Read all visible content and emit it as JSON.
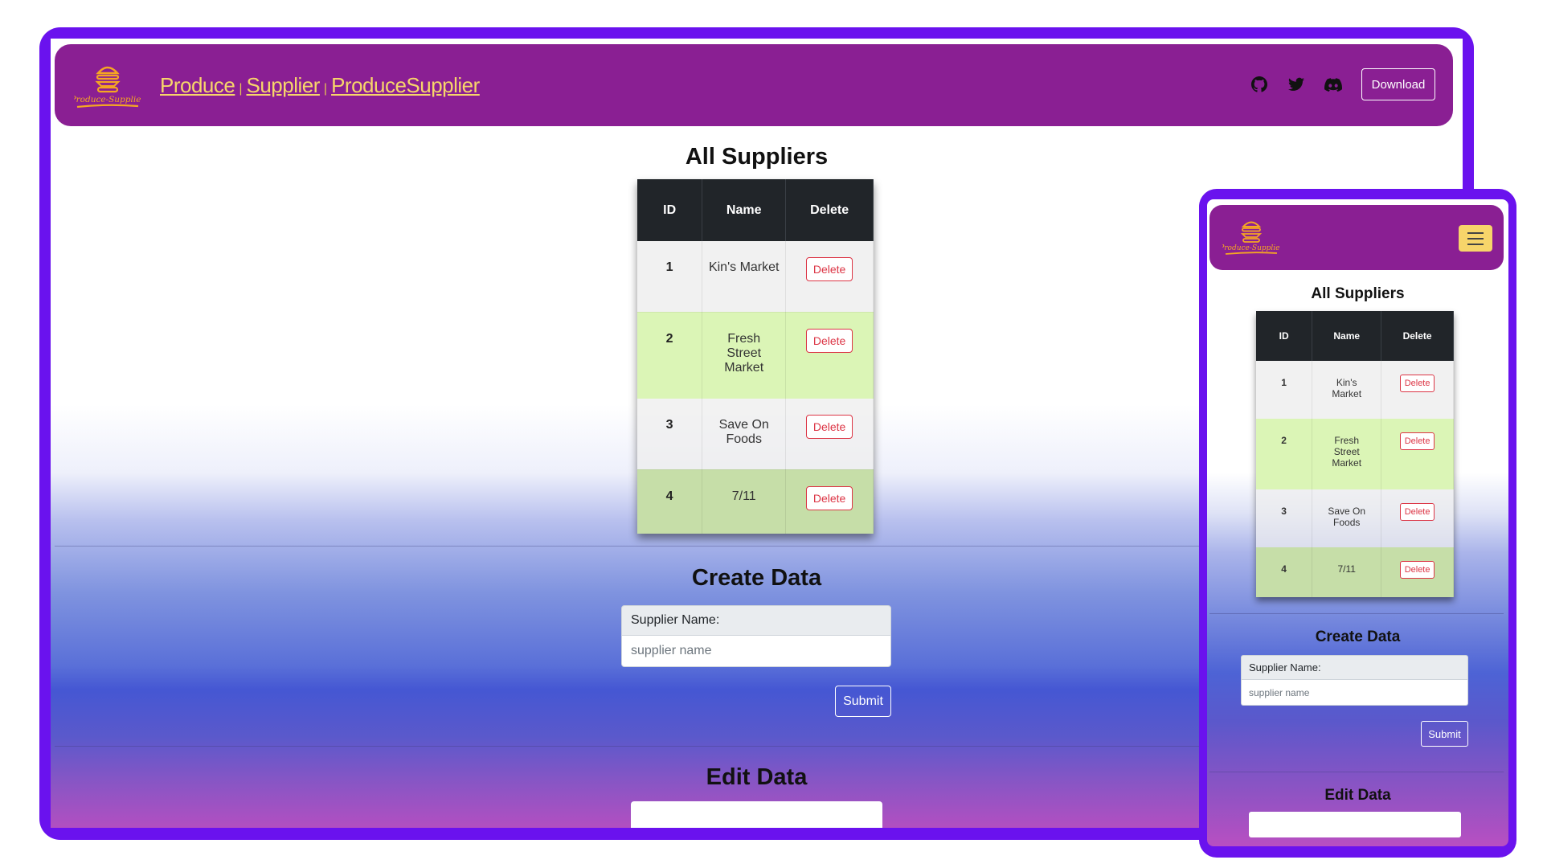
{
  "brand": {
    "logo_text": "Produce-Supplier",
    "logo_color": "#f5a623"
  },
  "nav": {
    "links": [
      "Produce",
      "Supplier",
      "ProduceSupplier"
    ],
    "separator": "|",
    "download_label": "Download",
    "icons": [
      "github-icon",
      "twitter-icon",
      "discord-icon"
    ]
  },
  "suppliers": {
    "title": "All Suppliers",
    "columns": [
      "ID",
      "Name",
      "Delete"
    ],
    "rows": [
      {
        "id": "1",
        "name": "Kin's Market",
        "action": "Delete"
      },
      {
        "id": "2",
        "name": "Fresh Street Market",
        "action": "Delete"
      },
      {
        "id": "3",
        "name": "Save On Foods",
        "action": "Delete"
      },
      {
        "id": "4",
        "name": "7/11",
        "action": "Delete"
      }
    ]
  },
  "create": {
    "title": "Create Data",
    "label": "Supplier Name:",
    "placeholder": "supplier name",
    "submit_label": "Submit"
  },
  "edit": {
    "title": "Edit Data"
  },
  "colors": {
    "frame": "#6a12ee",
    "navbar": "#8a1f93",
    "link": "#f7d56a",
    "danger": "#dc3545",
    "hamburger": "#f7d56a"
  }
}
